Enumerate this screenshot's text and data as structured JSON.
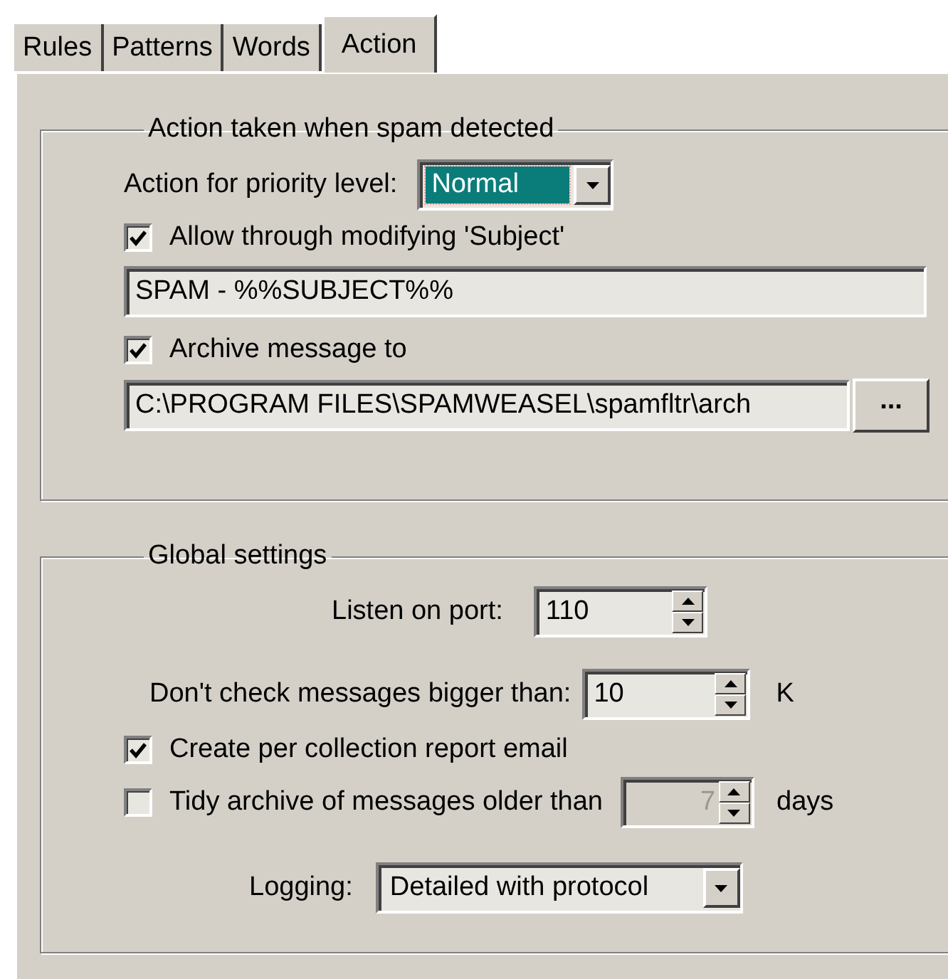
{
  "tabs": [
    {
      "label": "Rules",
      "selected": false
    },
    {
      "label": "Patterns",
      "selected": false
    },
    {
      "label": "Words",
      "selected": false
    },
    {
      "label": "Action",
      "selected": true
    }
  ],
  "action_group": {
    "title": "Action taken when spam detected",
    "priority": {
      "label": "Action for priority level:",
      "value": "Normal",
      "focused": true
    },
    "allow_through": {
      "label": "Allow through modifying 'Subject'",
      "checked": true
    },
    "subject_field": {
      "value": "SPAM - %%SUBJECT%%"
    },
    "archive": {
      "label": "Archive message to",
      "checked": true
    },
    "archive_path": {
      "value": "C:\\PROGRAM FILES\\SPAMWEASEL\\spamfltr\\arch"
    },
    "browse_button": "..."
  },
  "global_group": {
    "title": "Global settings",
    "port": {
      "label": "Listen on port:",
      "value": "110"
    },
    "size_limit": {
      "label": "Don't check messages bigger than:",
      "value": "10",
      "unit": "K"
    },
    "report": {
      "label": "Create per collection report email",
      "checked": true
    },
    "tidy": {
      "label": "Tidy archive of messages older than",
      "checked": false,
      "value": "7",
      "unit": "days"
    },
    "logging": {
      "label": "Logging:",
      "value": "Detailed with protocol"
    }
  }
}
